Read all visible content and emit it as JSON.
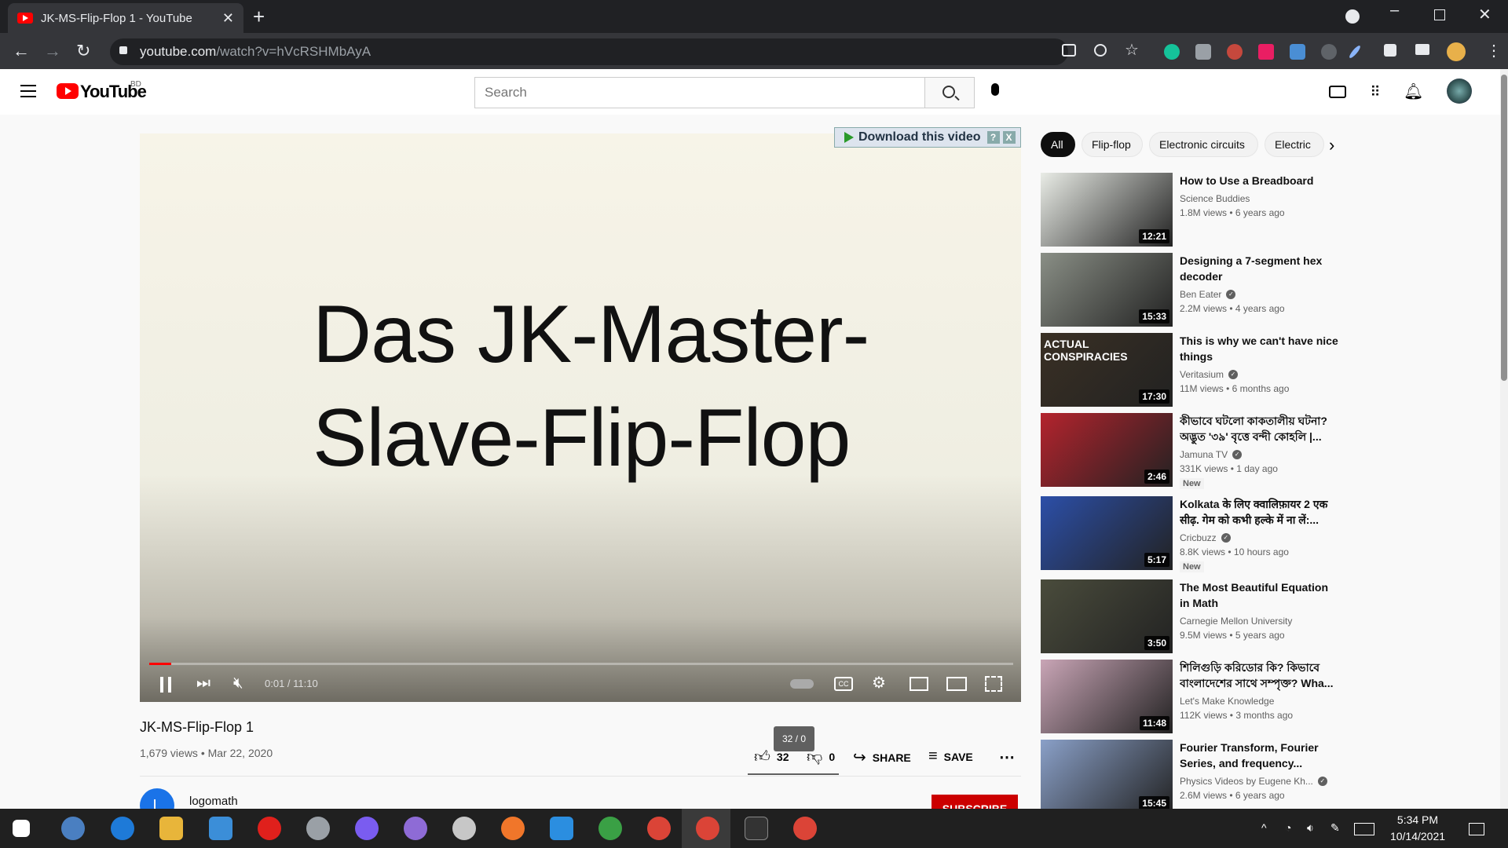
{
  "browser": {
    "tab_title": "JK-MS-Flip-Flop 1 - YouTube",
    "url_host": "youtube.com",
    "url_path": "/watch?v=hVcRSHMbAyA",
    "new_tab": "+",
    "close_tab": "✕"
  },
  "yt": {
    "logo_text": "YouTube",
    "region": "BD",
    "search_placeholder": "Search"
  },
  "player": {
    "overlay_title_line1": "Das JK-Master-",
    "overlay_title_line2": "Slave-Flip-Flop",
    "download_label": "Download this video",
    "help": "?",
    "close": "X",
    "time": "0:01 / 11:10",
    "progress": 0.003
  },
  "video": {
    "title": "JK-MS-Flip-Flop 1",
    "meta": "1,679 views • Mar 22, 2020",
    "likes": "32",
    "dislikes": "0",
    "tooltip": "32 / 0",
    "share": "SHARE",
    "save": "SAVE",
    "channel": "logomath",
    "channel_initial": "L",
    "subscribe": "SUBSCRIBE"
  },
  "chips": [
    "All",
    "Flip-flop",
    "Electronic circuits",
    "Electric"
  ],
  "recs": [
    {
      "title": "How to Use a Breadboard",
      "channel": "Science Buddies",
      "verified": false,
      "meta": "1.8M views • 6 years ago",
      "duration": "12:21",
      "new": "",
      "thumb": "#e9ece6"
    },
    {
      "title": "Designing a 7-segment hex decoder",
      "channel": "Ben Eater",
      "verified": true,
      "meta": "2.2M views • 4 years ago",
      "duration": "15:33",
      "new": "",
      "thumb": "#8a8f86"
    },
    {
      "title": "This is why we can't have nice things",
      "channel": "Veritasium",
      "verified": true,
      "meta": "11M views • 6 months ago",
      "duration": "17:30",
      "new": "",
      "thumb": "#3a3024",
      "thumb_text": "ACTUAL CONSPIRACIES"
    },
    {
      "title": "কীভাবে ঘটলো কাকতালীয় ঘটনা? অদ্ভুত '৩৯' বৃত্তে বন্দী কোহলি |...",
      "channel": "Jamuna TV",
      "verified": true,
      "meta": "331K views • 1 day ago",
      "duration": "2:46",
      "new": "New",
      "thumb": "#b4232d"
    },
    {
      "title": "Kolkata के लिए क्वालिफ़ायर 2 एक सीढ़. गेम को कभी हल्के में ना लें:...",
      "channel": "Cricbuzz",
      "verified": true,
      "meta": "8.8K views • 10 hours ago",
      "duration": "5:17",
      "new": "New",
      "thumb": "#2c4fa8"
    },
    {
      "title": "The Most Beautiful Equation in Math",
      "channel": "Carnegie Mellon University",
      "verified": false,
      "meta": "9.5M views • 5 years ago",
      "duration": "3:50",
      "new": "",
      "thumb": "#4a4c3c"
    },
    {
      "title": "শিলিগুড়ি করিডোর কি? কিভাবে বাংলাদেশের সাথে সম্পৃক্ত? Wha...",
      "channel": "Let's Make Knowledge",
      "verified": false,
      "meta": "112K views • 3 months ago",
      "duration": "11:48",
      "new": "",
      "thumb": "#c9a5b6"
    },
    {
      "title": "Fourier Transform, Fourier Series, and frequency...",
      "channel": "Physics Videos by Eugene Kh...",
      "verified": true,
      "meta": "2.6M views • 6 years ago",
      "duration": "15:45",
      "new": "",
      "thumb": "#8aa0c8"
    }
  ],
  "taskbar": {
    "time": "5:34 PM",
    "date": "10/14/2021"
  }
}
